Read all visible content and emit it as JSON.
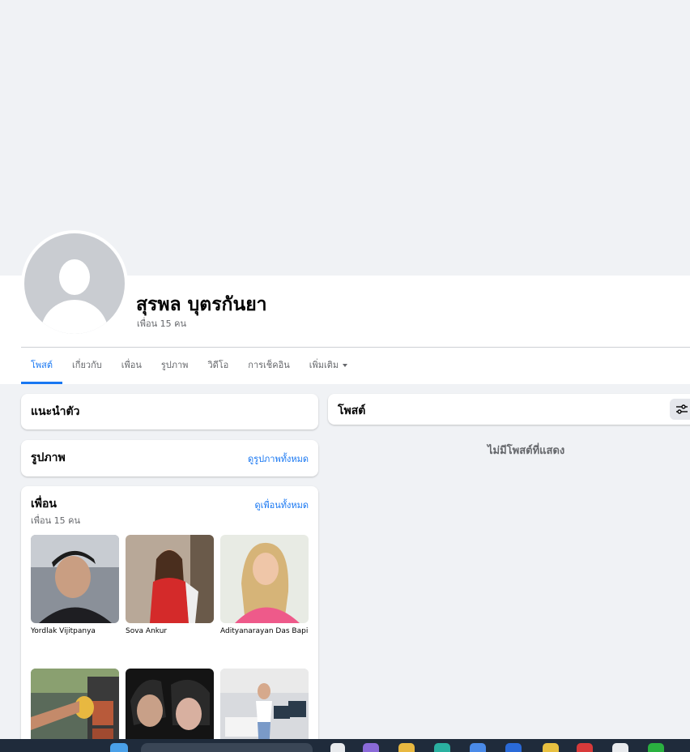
{
  "profile": {
    "name": "สุรพล บุตรกันยา",
    "friend_count_text": "เพื่อน 15 คน"
  },
  "tabs": [
    {
      "label": "โพสต์",
      "active": true
    },
    {
      "label": "เกี่ยวกับ"
    },
    {
      "label": "เพื่อน"
    },
    {
      "label": "รูปภาพ"
    },
    {
      "label": "วิดีโอ"
    },
    {
      "label": "การเช็คอิน"
    },
    {
      "label": "เพิ่มเติม"
    }
  ],
  "intro": {
    "title": "แนะนำตัว"
  },
  "photos": {
    "title": "รูปภาพ",
    "see_all": "ดูรูปภาพทั้งหมด"
  },
  "friends": {
    "title": "เพื่อน",
    "subtitle": "เพื่อน 15 คน",
    "see_all": "ดูเพื่อนทั้งหมด",
    "list": [
      {
        "name": "Yordlak Vijitpanya"
      },
      {
        "name": "Sova Ankur"
      },
      {
        "name": "Adityanarayan Das Bapi"
      },
      {
        "name": ""
      },
      {
        "name": ""
      },
      {
        "name": ""
      }
    ]
  },
  "posts": {
    "title": "โพสต์",
    "empty_text": "ไม่มีโพสต์ที่แสดง"
  },
  "colors": {
    "accent": "#1877f2",
    "background": "#f0f2f5",
    "secondary_text": "#65676b"
  }
}
